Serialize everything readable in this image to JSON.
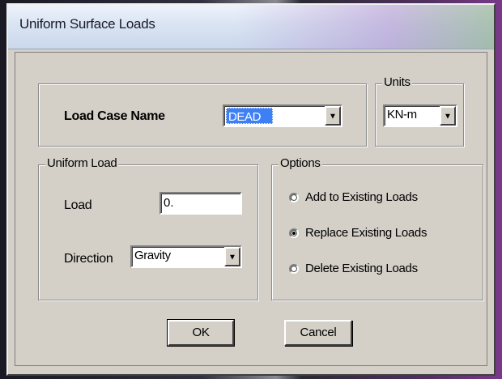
{
  "dialog": {
    "title": "Uniform Surface Loads"
  },
  "load_case": {
    "label": "Load Case Name",
    "value": "DEAD"
  },
  "units": {
    "caption": "Units",
    "value": "KN-m"
  },
  "uniform_load": {
    "caption": "Uniform Load",
    "load_label": "Load",
    "load_value": "0.",
    "direction_label": "Direction",
    "direction_value": "Gravity"
  },
  "options": {
    "caption": "Options",
    "items": [
      {
        "label": "Add to Existing Loads",
        "selected": false
      },
      {
        "label": "Replace Existing Loads",
        "selected": true
      },
      {
        "label": "Delete Existing Loads",
        "selected": false
      }
    ]
  },
  "buttons": {
    "ok": "OK",
    "cancel": "Cancel"
  },
  "colors": {
    "dialog_bg": "#d4d0c8",
    "selection": "#3d7ff5"
  }
}
